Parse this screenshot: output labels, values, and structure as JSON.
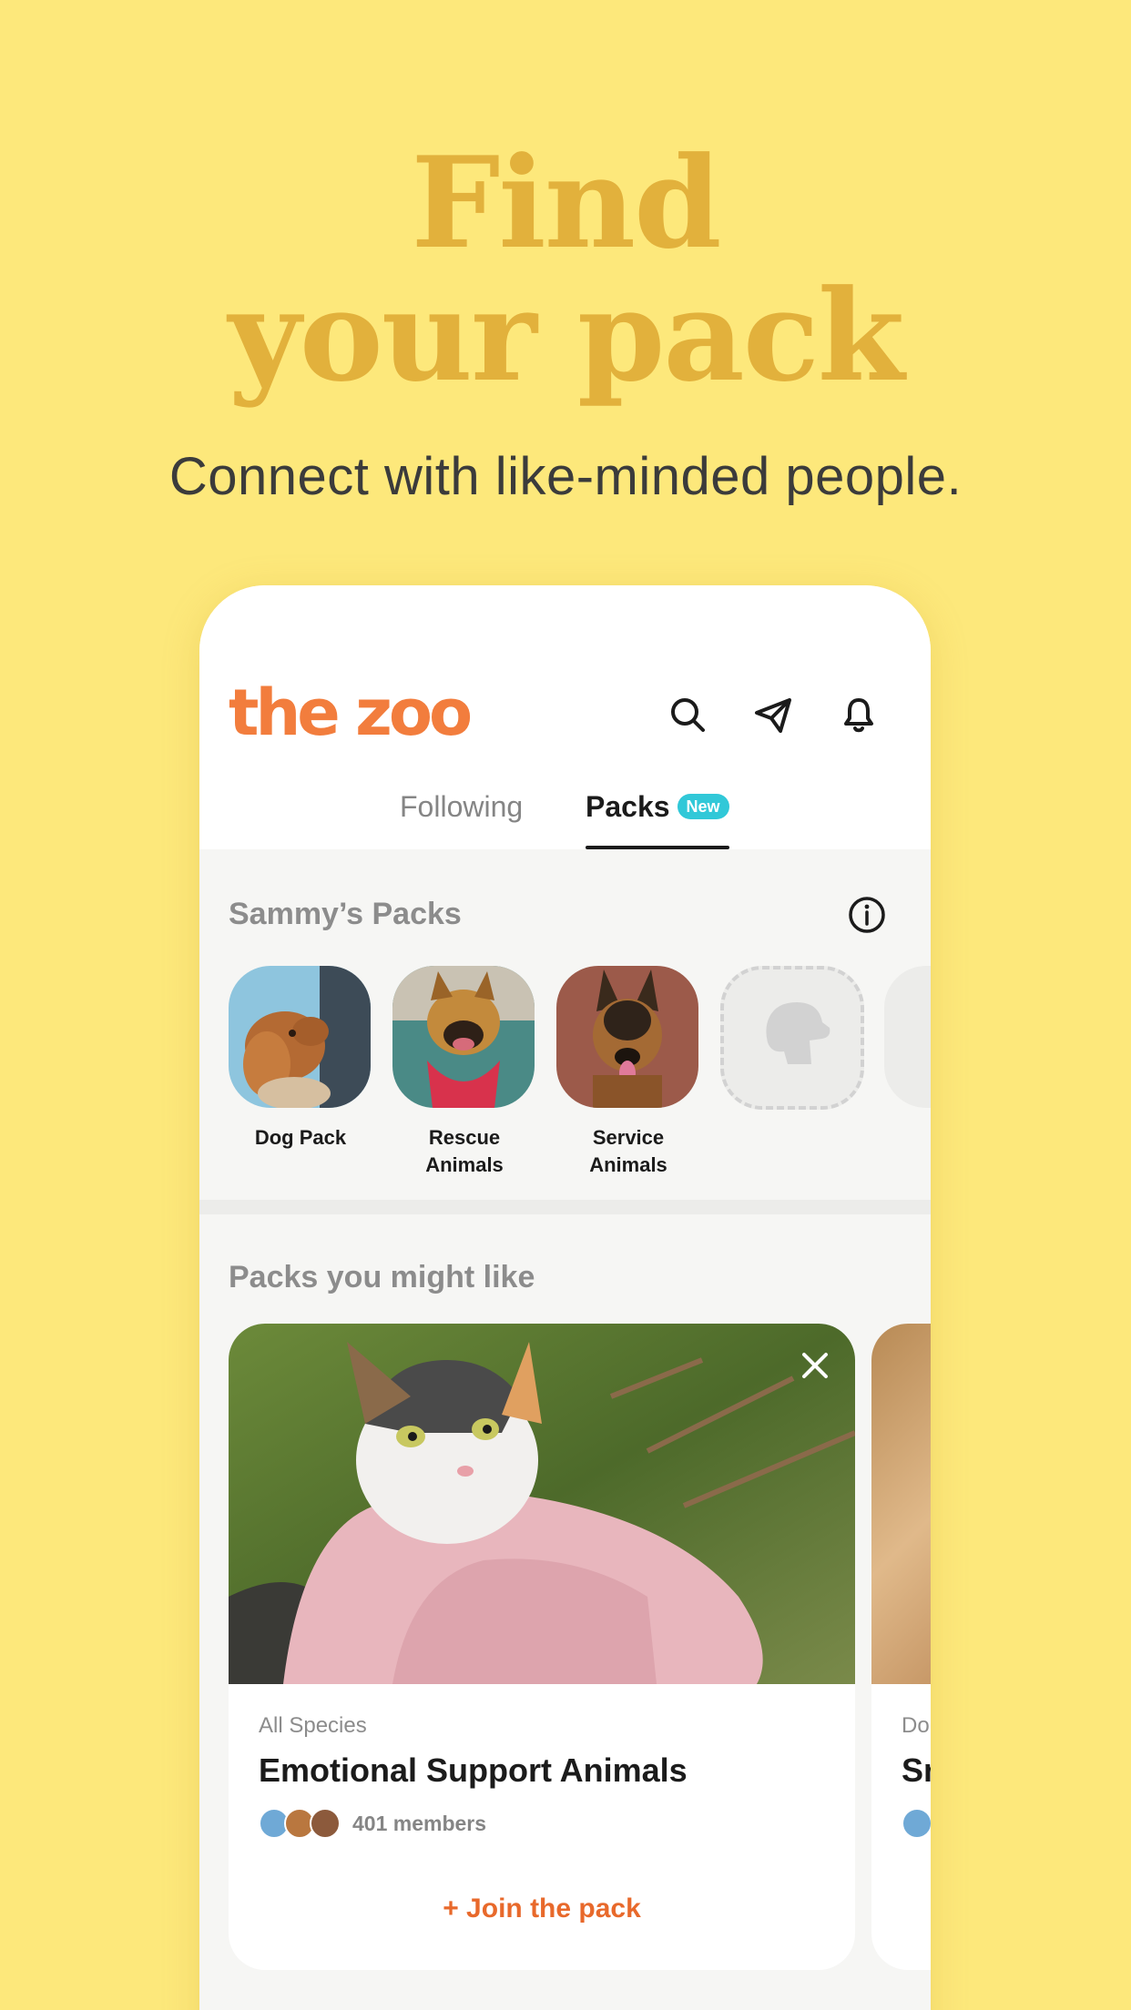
{
  "hero": {
    "title_line1": "Find",
    "title_line2": "your pack",
    "subtitle": "Connect with like-minded people."
  },
  "app": {
    "logo": "the zoo",
    "icons": [
      "search-icon",
      "paper-plane-icon",
      "bell-icon"
    ],
    "tabs": {
      "following": "Following",
      "packs": "Packs",
      "packs_badge": "New"
    }
  },
  "my_packs": {
    "title": "Sammy’s Packs",
    "items": [
      {
        "label": "Dog Pack"
      },
      {
        "label": "Rescue Animals"
      },
      {
        "label": "Service Animals"
      }
    ]
  },
  "suggested": {
    "title": "Packs you might like",
    "cards": [
      {
        "species": "All Species",
        "name": "Emotional Support Animals",
        "members": "401 members",
        "join_label": "+ Join the pack"
      },
      {
        "species": "Do",
        "name": "Sn"
      }
    ]
  },
  "colors": {
    "background": "#fde87b",
    "headline": "#e2b13c",
    "logo": "#f27d3d",
    "badge": "#31c8d8",
    "join": "#e8692b"
  }
}
